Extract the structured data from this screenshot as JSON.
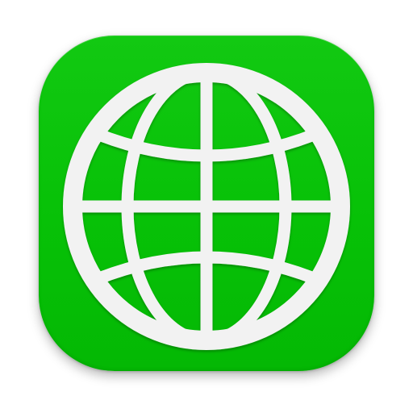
{
  "icon": {
    "name": "globe-icon",
    "kind": "app-icon",
    "background_color": "#08c208",
    "glyph_color": "#f2f2f2"
  }
}
